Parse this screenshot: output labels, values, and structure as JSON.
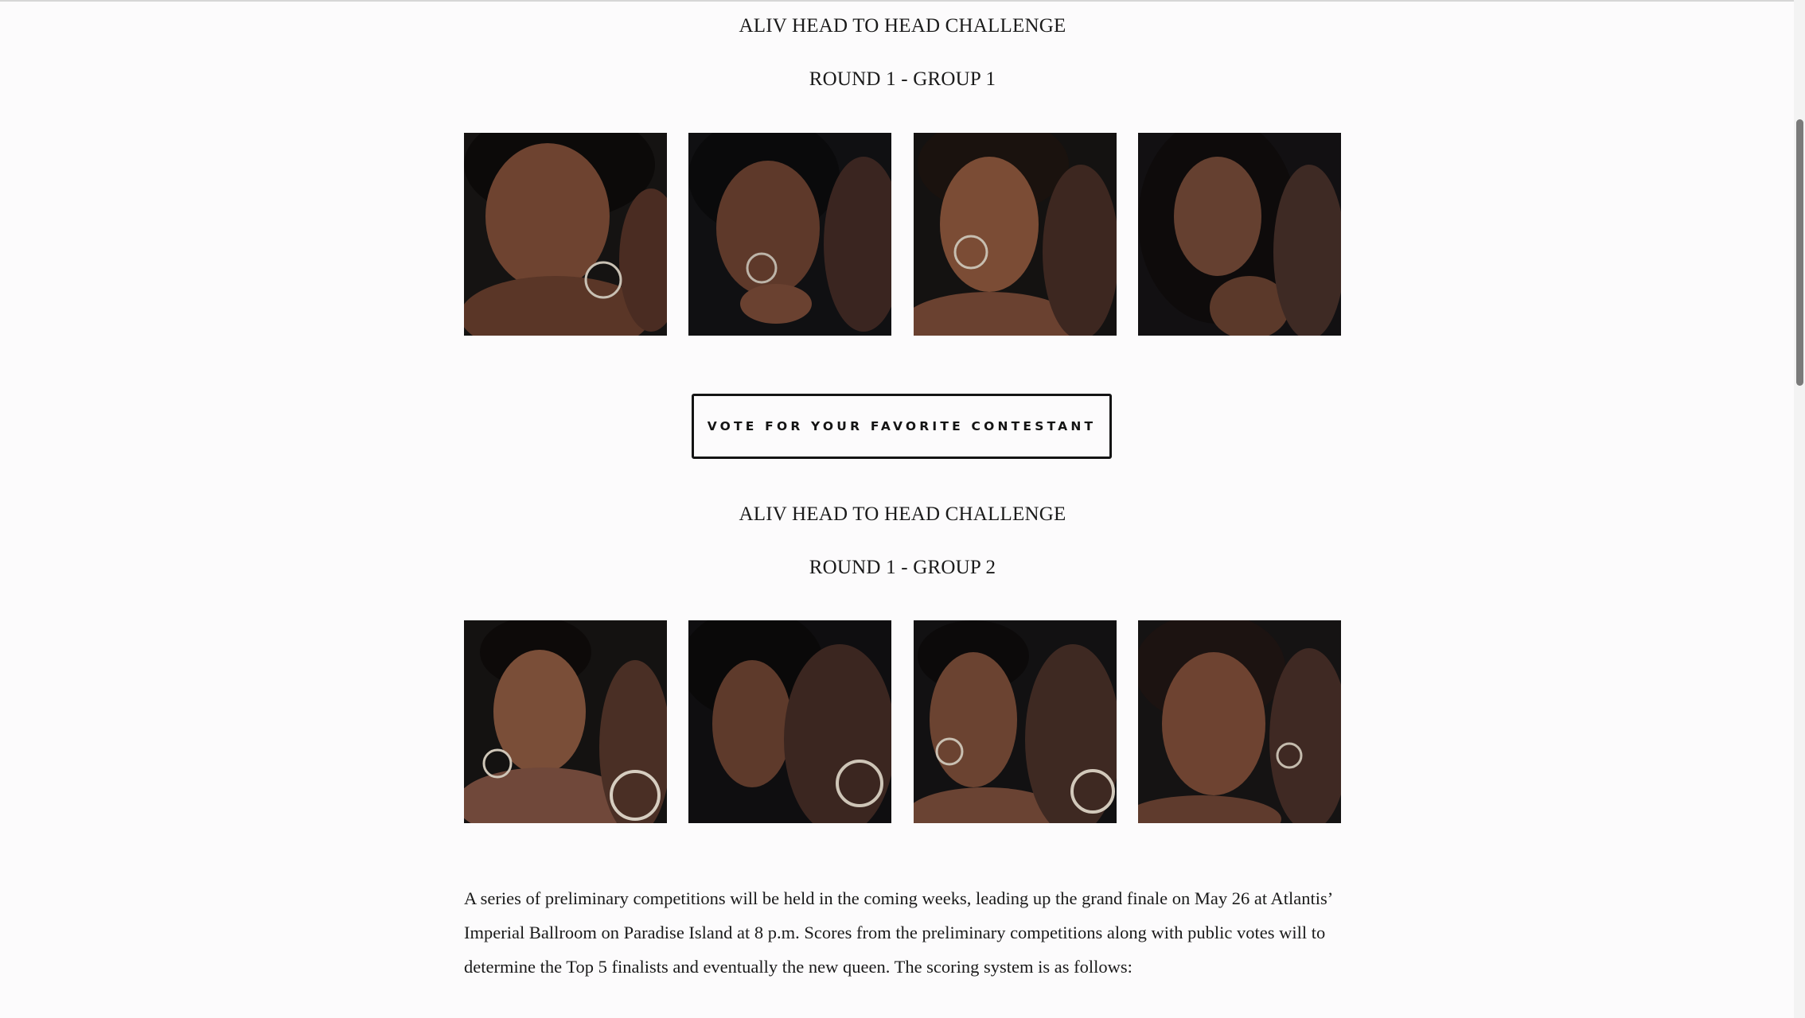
{
  "group1": {
    "heading": "ALIV HEAD TO HEAD CHALLENGE",
    "subheading": "ROUND 1 - GROUP 1"
  },
  "vote_button": {
    "label": "VOTE FOR YOUR FAVORITE CONTESTANT"
  },
  "group2": {
    "heading": "ALIV HEAD TO HEAD CHALLENGE",
    "subheading": "ROUND 1 - GROUP 2"
  },
  "body": {
    "paragraph": "A series of preliminary competitions will be held in the coming weeks, leading up the grand finale on May 26 at Atlantis’ Imperial Ballroom on Paradise Island at 8 p.m. Scores from the preliminary competitions along with public votes will to determine the Top 5 finalists and eventually the new queen.  The scoring system is as follows:"
  },
  "colors": {
    "page_background": "#fcfbfc",
    "text": "#1a1a1a",
    "button_border": "#141414",
    "photo_background": "#111111",
    "skin_tone": "#7a4a32"
  },
  "scrollbar": {
    "position_fraction": 0.12
  }
}
